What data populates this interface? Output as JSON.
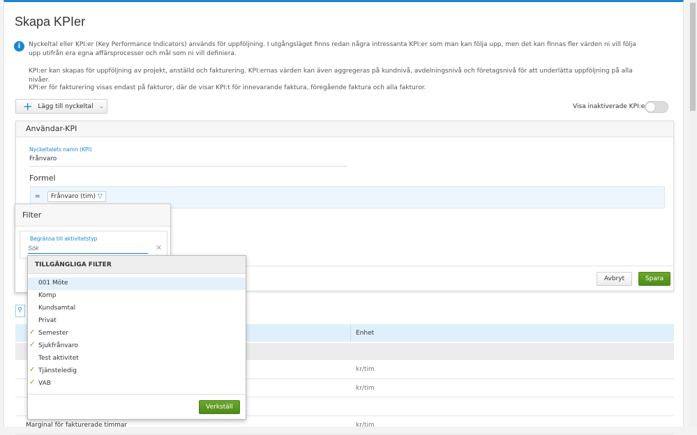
{
  "page": {
    "title": "Skapa KPIer",
    "info": [
      "Nyckeltal eller KPI:er (Key Performance Indicators) används för uppföljning. I utgångsläget finns redan några intressanta KPI:er som man kan följa upp, men det kan finnas fler värden ni vill följa upp utifrån era egna affärsprocesser och mål som ni vill definiera.",
      "KPI:er kan skapas för uppföljning av projekt, anställd och fakturering. KPI:ernas värden kan även aggregeras på kundnivå, avdelningsnivå och företagsnivå för att underlätta uppföljning på alla nivåer.",
      "KPI:er för fakturering visas endast på fakturor, där de visar KPI:t för innevarande faktura, föregående faktura och alla fakturor."
    ]
  },
  "toolbar": {
    "add_label": "Lägg till nyckeltal",
    "toggle_label": "Visa inaktiverade KPI:er",
    "toggle_on": false
  },
  "card": {
    "title": "Användar-KPI",
    "name_label": "Nyckeltalets namn (KPI)",
    "name_value": "Frånvaro",
    "formula_heading": "Formel",
    "equals": "=",
    "chip": "Frånvaro (tim)",
    "cancel": "Avbryt",
    "save": "Spara"
  },
  "filter": {
    "title": "Filter",
    "field_label": "Begränsa till aktivitetstyp",
    "placeholder": "Sök",
    "list_header": "TILLGÄNGLIGA FILTER",
    "items": [
      {
        "label": "001 Möte",
        "checked": false
      },
      {
        "label": "Komp",
        "checked": false
      },
      {
        "label": "Kundsamtal",
        "checked": false
      },
      {
        "label": "Privat",
        "checked": false
      },
      {
        "label": "Semester",
        "checked": true
      },
      {
        "label": "Sjukfrånvaro",
        "checked": true
      },
      {
        "label": "Test aktivitet",
        "checked": false
      },
      {
        "label": "Tjänsteledig",
        "checked": true
      },
      {
        "label": "VAB",
        "checked": true
      }
    ],
    "apply": "Verkställ"
  },
  "table": {
    "col_unit": "Enhet",
    "rows": [
      {
        "unit": "kr/tim"
      },
      {
        "unit": "kr/tim"
      },
      {
        "name": "Marginal för fakturerade timmar",
        "unit": "kr/tim"
      }
    ]
  }
}
